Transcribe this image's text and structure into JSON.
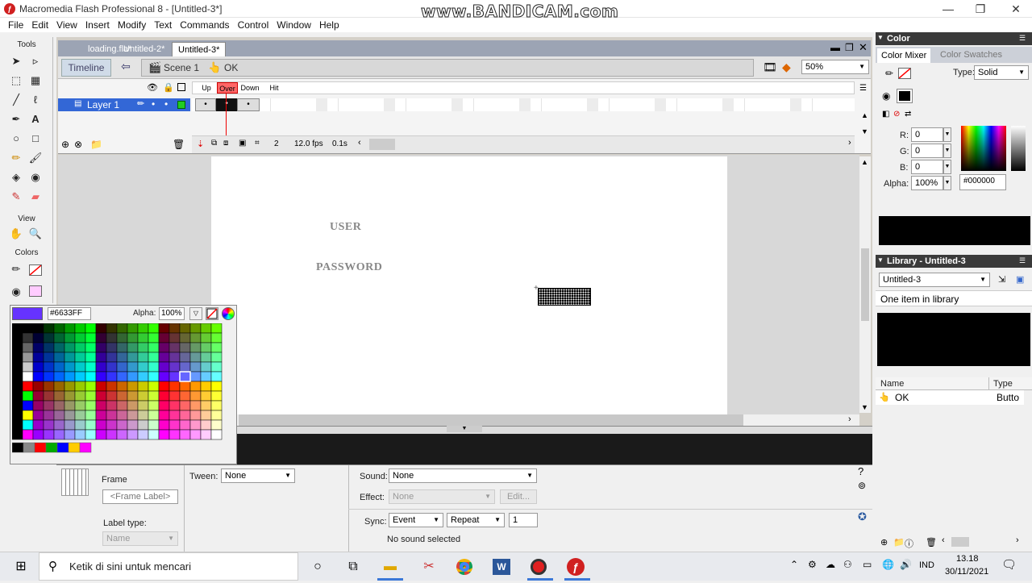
{
  "window": {
    "title": "Macromedia Flash Professional 8 - [Untitled-3*]",
    "app_icon": "flash-icon",
    "watermark": "www.BANDICAM.com",
    "controls": [
      "—",
      "❐",
      "✕"
    ]
  },
  "menu": [
    "File",
    "Edit",
    "View",
    "Insert",
    "Modify",
    "Text",
    "Commands",
    "Control",
    "Window",
    "Help"
  ],
  "tools": {
    "header": "Tools",
    "view_label": "View",
    "colors_label": "Colors"
  },
  "doc_tabs": [
    {
      "label": "loading.fla*",
      "active": false
    },
    {
      "label": "Untitled-2*",
      "active": false
    },
    {
      "label": "Untitled-3*",
      "active": true
    }
  ],
  "edit_bar": {
    "timeline_btn": "Timeline",
    "scene": "Scene 1",
    "symbol": "OK",
    "zoom": "50%"
  },
  "timeline": {
    "frame_labels": [
      "Up",
      "Over",
      "Down",
      "Hit"
    ],
    "layer": "Layer 1",
    "current_frame": "2",
    "fps": "12.0 fps",
    "time": "0.1s"
  },
  "stage": {
    "user_label": "USER",
    "password_label": "PASSWORD"
  },
  "swatch_popup": {
    "hex": "#6633FF",
    "alpha_label": "Alpha:",
    "alpha": "100%",
    "selected_color": "#6633FF"
  },
  "properties": {
    "type": "Frame",
    "frame_label_placeholder": "<Frame Label>",
    "label_type_label": "Label type:",
    "label_type": "Name",
    "tween_label": "Tween:",
    "tween": "None",
    "sound_label": "Sound:",
    "sound": "None",
    "effect_label": "Effect:",
    "effect": "None",
    "edit_btn": "Edit...",
    "sync_label": "Sync:",
    "sync": "Event",
    "repeat": "Repeat",
    "repeat_count": "1",
    "sound_status": "No sound selected"
  },
  "color_panel": {
    "title": "Color",
    "tab_mixer": "Color Mixer",
    "tab_swatches": "Color Swatches",
    "type_label": "Type:",
    "type": "Solid",
    "r_label": "R:",
    "r": "0",
    "g_label": "G:",
    "g": "0",
    "b_label": "B:",
    "b": "0",
    "alpha_label": "Alpha:",
    "alpha": "100%",
    "hex": "#000000"
  },
  "library": {
    "title": "Library - Untitled-3",
    "doc": "Untitled-3",
    "count": "One item in library",
    "col_name": "Name",
    "col_type": "Type",
    "items": [
      {
        "name": "OK",
        "type": "Butto"
      }
    ]
  },
  "taskbar": {
    "search_placeholder": "Ketik di sini untuk mencari",
    "lang": "IND",
    "time": "13.18",
    "date": "30/11/2021"
  }
}
